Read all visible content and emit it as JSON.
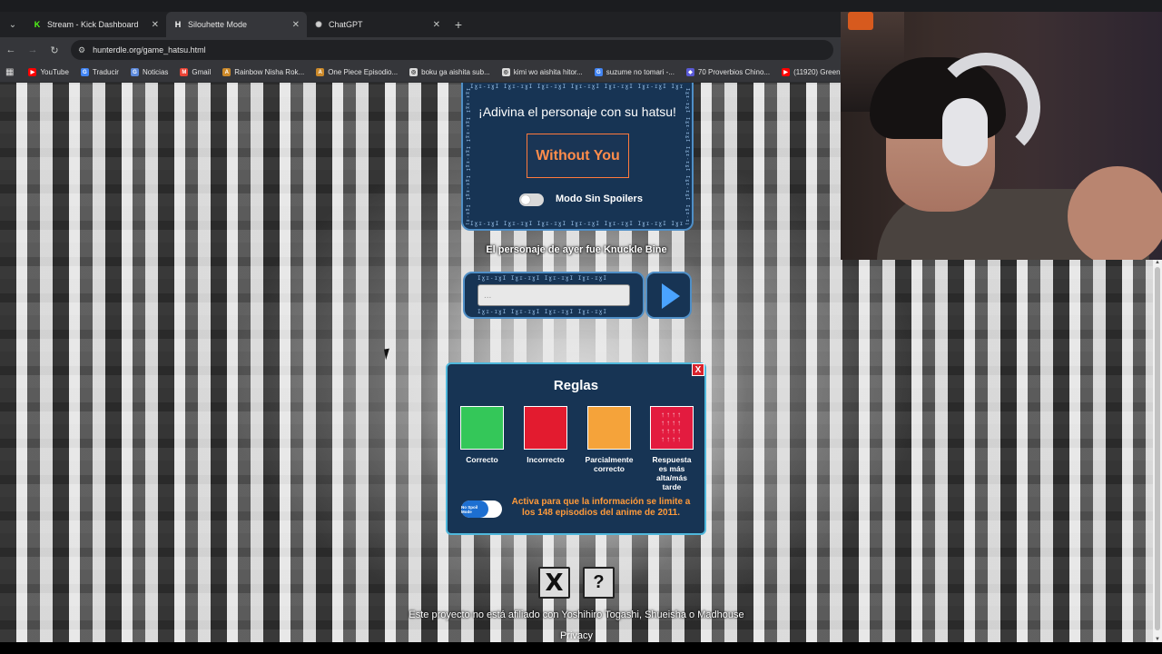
{
  "browser": {
    "tabs": [
      {
        "label": "Stream - Kick Dashboard",
        "favicon": "K",
        "favicon_color": "#53fc18",
        "active": false
      },
      {
        "label": "Silouhette Mode",
        "favicon": "H",
        "favicon_color": "#ffffff",
        "active": true
      },
      {
        "label": "ChatGPT",
        "favicon": "✺",
        "favicon_color": "#d0d0d0",
        "active": false
      }
    ],
    "new_tab_icon": "plus-icon",
    "url": "hunterdle.org/game_hatsu.html",
    "bookmarks": [
      {
        "label": "YouTube",
        "icon_color": "#ff0000"
      },
      {
        "label": "Traducir",
        "icon_color": "#4285f4"
      },
      {
        "label": "Noticias",
        "icon_color": "#5e8bdc"
      },
      {
        "label": "Gmail",
        "icon_color": "#ea4335"
      },
      {
        "label": "Rainbow Nisha Rok...",
        "icon_color": "#cc8a2a"
      },
      {
        "label": "One Piece Episodio...",
        "icon_color": "#cc8a2a"
      },
      {
        "label": "boku ga aishita sub...",
        "icon_color": "#dadada"
      },
      {
        "label": "kimi wo aishita hitor...",
        "icon_color": "#dadada"
      },
      {
        "label": "suzume no tomari -...",
        "icon_color": "#4285f4"
      },
      {
        "label": "70 Proverbios Chino...",
        "icon_color": "#5a5ad6"
      },
      {
        "label": "(11920) Green...",
        "icon_color": "#ff0000"
      }
    ]
  },
  "game": {
    "title": "¡Adivina el personaje con su hatsu!",
    "hint": "Without You",
    "spoiler_toggle_label": "Modo Sin Spoilers",
    "spoiler_toggle_on": false,
    "yesterday": "El personaje de ayer fue Knuckle Bine",
    "input_placeholder": "...",
    "submit_icon": "play-icon"
  },
  "rules": {
    "close": "X",
    "title": "Reglas",
    "items": [
      {
        "label": "Correcto",
        "color": "#34c759"
      },
      {
        "label": "Incorrecto",
        "color": "#e31b2f"
      },
      {
        "label": "Parcialmente correcto",
        "color": "#f5a33a"
      },
      {
        "label": "Respuesta es más alta/más tarde",
        "color": "#e31b3f"
      }
    ],
    "badge": "No Spoil Mode",
    "note": "Activa para que la información se limite a los 148 episodios del anime de 2011."
  },
  "footer": {
    "x_icon": "X",
    "help_icon": "?",
    "disclaimer": "Este proyecto no está afiliado con Yoshihiro Togashi, Shueisha o Madhouse",
    "privacy": "Privacy"
  }
}
